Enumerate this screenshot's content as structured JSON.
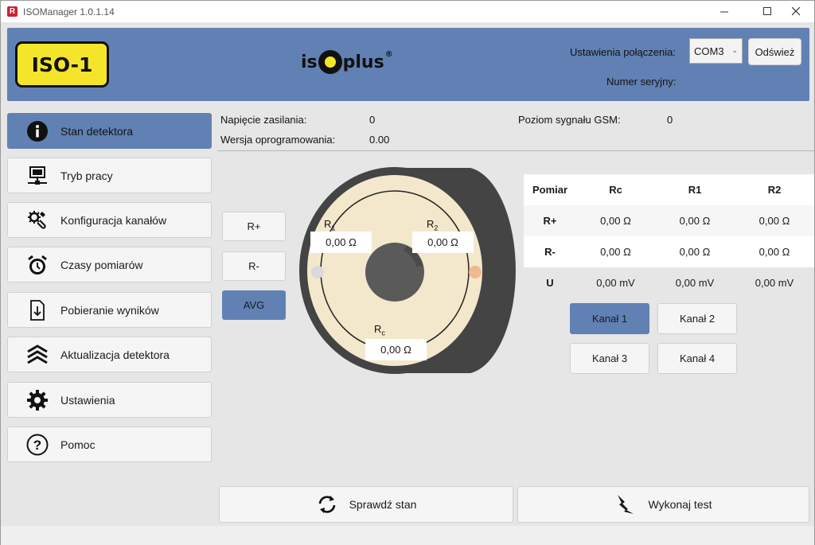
{
  "window": {
    "title": "ISOManager 1.0.1.14",
    "icon_letter": "R"
  },
  "header": {
    "logo_text": "ISO-1",
    "brand": {
      "left": "is",
      "right": "plus",
      "reg": "®"
    },
    "connection_label": "Ustawienia połączenia:",
    "com_port": "COM3",
    "refresh_label": "Odśwież",
    "serial_label": "Numer seryjny:"
  },
  "sidebar": {
    "items": [
      {
        "label": "Stan detektora",
        "icon": "info-icon"
      },
      {
        "label": "Tryb pracy",
        "icon": "computer-network-icon"
      },
      {
        "label": "Konfiguracja kanałów",
        "icon": "channel-config-icon"
      },
      {
        "label": "Czasy pomiarów",
        "icon": "alarm-clock-icon"
      },
      {
        "label": "Pobieranie wyników",
        "icon": "download-file-icon"
      },
      {
        "label": "Aktualizacja detektora",
        "icon": "update-chevrons-icon"
      },
      {
        "label": "Ustawienia",
        "icon": "gear-icon"
      },
      {
        "label": "Pomoc",
        "icon": "help-icon"
      }
    ]
  },
  "status": {
    "supply_voltage_label": "Napięcie zasilania:",
    "supply_voltage_value": "0",
    "software_version_label": "Wersja oprogramowania:",
    "software_version_value": "0.00",
    "gsm_label": "Poziom sygnału GSM:",
    "gsm_value": "0"
  },
  "mode_buttons": {
    "r_plus": "R+",
    "r_minus": "R-",
    "avg": "AVG"
  },
  "diagram": {
    "r1_label": "R",
    "r1_sub": "1",
    "r1_value": "0,00 Ω",
    "r2_label": "R",
    "r2_sub": "2",
    "r2_value": "0,00 Ω",
    "rc_label": "R",
    "rc_sub": "c",
    "rc_value": "0,00 Ω",
    "colors": {
      "pipe": "#444444",
      "insulation": "#f3e8cc",
      "core": "#5a5a5a",
      "left_dot": "#d9d9d9",
      "right_dot": "#f1b98f"
    }
  },
  "table": {
    "headers": [
      "Pomiar",
      "Rc",
      "R1",
      "R2"
    ],
    "rows": [
      [
        "R+",
        "0,00 Ω",
        "0,00 Ω",
        "0,00 Ω"
      ],
      [
        "R-",
        "0,00 Ω",
        "0,00 Ω",
        "0,00 Ω"
      ],
      [
        "U",
        "0,00 mV",
        "0,00 mV",
        "0,00 mV"
      ]
    ]
  },
  "channels": [
    "Kanał 1",
    "Kanał 2",
    "Kanał 3",
    "Kanał 4"
  ],
  "actions": {
    "check_status": "Sprawdź stan",
    "run_test": "Wykonaj test"
  },
  "colors": {
    "accent": "#6181b4",
    "logo_yellow": "#f5e52a"
  }
}
